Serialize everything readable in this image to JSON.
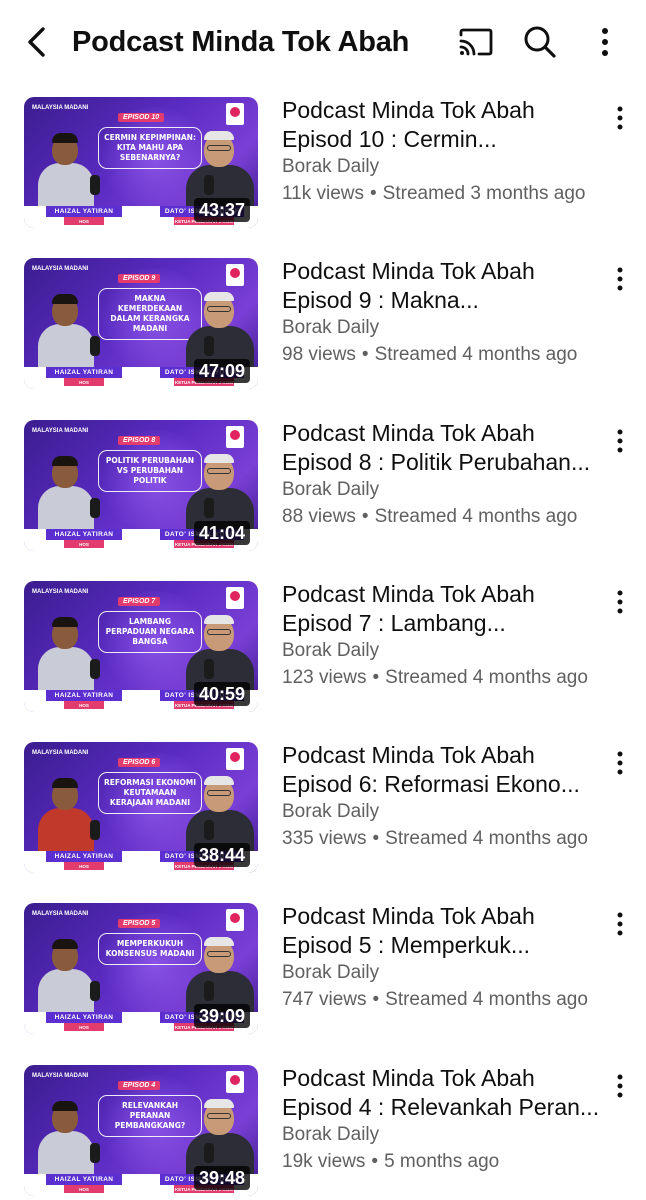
{
  "header": {
    "title": "Podcast Minda Tok Abah",
    "icons": [
      "back-arrow-icon",
      "cast-icon",
      "search-icon",
      "more-vertical-icon"
    ]
  },
  "thumbnail_common": {
    "brand": "MALAYSIA MADANI",
    "host_name": "HAIZAL YATIRAN",
    "host_role": "HOS",
    "guest_name": "DATO' ISMAIL YUSOF",
    "guest_role": "KETUA PENGARAH J-KOM"
  },
  "videos": [
    {
      "title_line1": "Podcast Minda Tok Abah",
      "title_line2": "Episod 10 : Cermin...",
      "channel": "Borak Daily",
      "views": "11k views",
      "when": "Streamed 3 months ago",
      "duration": "43:37",
      "episode_tag": "EPISOD 10",
      "topic": "Cermin Kepimpinan: Kita Mahu Apa Sebenarnya?"
    },
    {
      "title_line1": "Podcast Minda Tok Abah",
      "title_line2": "Episod 9 : Makna...",
      "channel": "Borak Daily",
      "views": "98 views",
      "when": "Streamed 4 months ago",
      "duration": "47:09",
      "episode_tag": "EPISOD 9",
      "topic": "Makna Kemerdekaan Dalam Kerangka Madani"
    },
    {
      "title_line1": "Podcast Minda Tok Abah",
      "title_line2": "Episod 8 : Politik Perubahan...",
      "channel": "Borak Daily",
      "views": "88 views",
      "when": "Streamed 4 months ago",
      "duration": "41:04",
      "episode_tag": "EPISOD 8",
      "topic": "Politik Perubahan VS Perubahan Politik"
    },
    {
      "title_line1": "Podcast Minda Tok Abah",
      "title_line2": "Episod 7 : Lambang...",
      "channel": "Borak Daily",
      "views": "123 views",
      "when": "Streamed 4 months ago",
      "duration": "40:59",
      "episode_tag": "EPISOD 7",
      "topic": "Lambang Perpaduan Negara Bangsa"
    },
    {
      "title_line1": "Podcast Minda Tok Abah",
      "title_line2": "Episod 6: Reformasi Ekono...",
      "channel": "Borak Daily",
      "views": "335 views",
      "when": "Streamed 4 months ago",
      "duration": "38:44",
      "episode_tag": "EPISOD 6",
      "topic": "Reformasi Ekonomi Keutamaan Kerajaan Madani"
    },
    {
      "title_line1": "Podcast Minda Tok Abah",
      "title_line2": "Episod 5 : Memperkuk...",
      "channel": "Borak Daily",
      "views": "747 views",
      "when": "Streamed 4 months ago",
      "duration": "39:09",
      "episode_tag": "EPISOD 5",
      "topic": "Memperkukuh Konsensus Madani"
    },
    {
      "title_line1": "Podcast Minda Tok Abah",
      "title_line2": "Episod 4 : Relevankah Peran...",
      "channel": "Borak Daily",
      "views": "19k views",
      "when": "5 months ago",
      "duration": "39:48",
      "episode_tag": "EPISOD 4",
      "topic": "Relevankah Peranan Pembangkang?"
    }
  ],
  "separator": "•",
  "colors": {
    "text_primary": "#0f0f0f",
    "text_secondary": "#606060",
    "thumb_purple": "#5a2bc2",
    "tag_pink": "#e23b6e"
  }
}
